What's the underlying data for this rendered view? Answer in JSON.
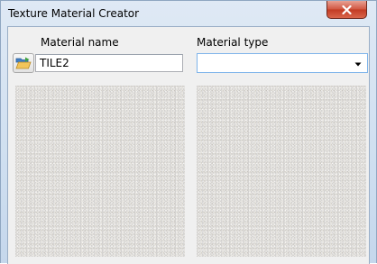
{
  "window": {
    "title": "Texture Material Creator"
  },
  "form": {
    "material_name_label": "Material name",
    "material_name_value": "TILE2",
    "material_type_label": "Material type",
    "material_type_value": ""
  },
  "icons": {
    "close": "close-icon",
    "open_folder": "open-folder-icon",
    "dropdown": "chevron-down-icon"
  },
  "colors": {
    "close_button": "#c9452c",
    "texture_base": "#e7e5e1",
    "select_focus_border": "#7eb4ea"
  }
}
